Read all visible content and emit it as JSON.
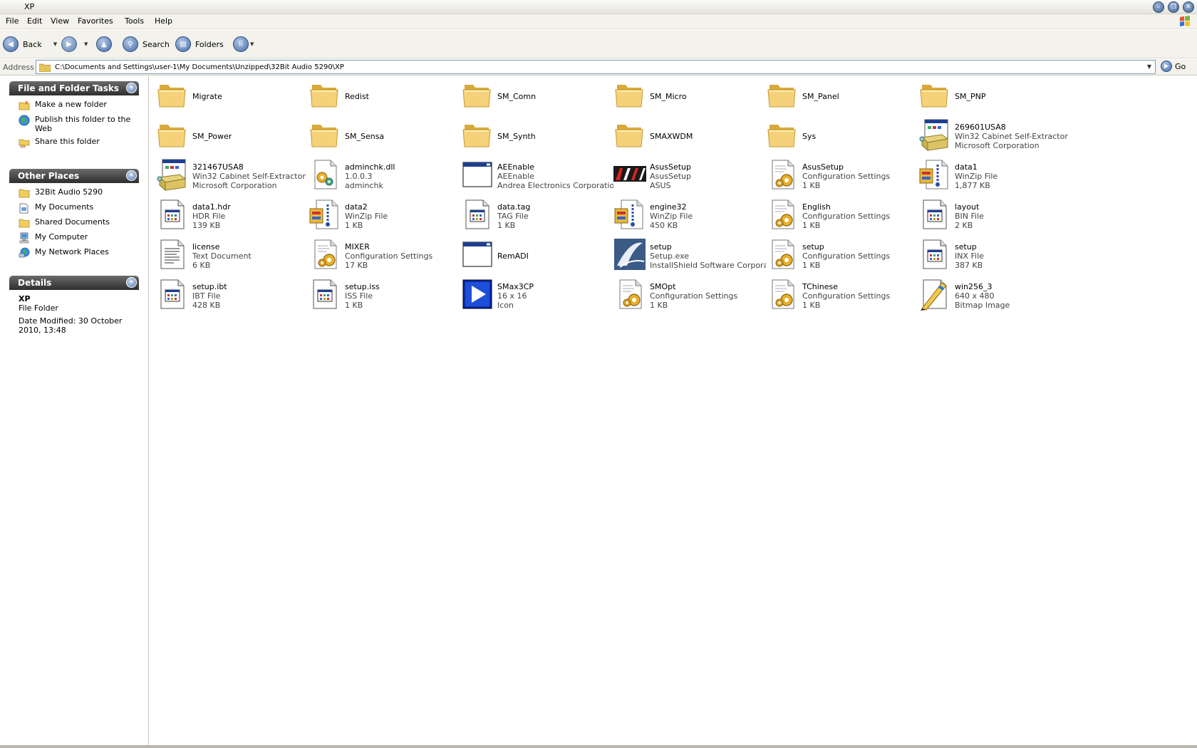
{
  "window": {
    "title": "XP"
  },
  "menu": [
    "File",
    "Edit",
    "View",
    "Favorites",
    "Tools",
    "Help"
  ],
  "toolbar": {
    "back": "Back",
    "search": "Search",
    "folders": "Folders"
  },
  "address": {
    "label": "Address",
    "path": "C:\\Documents and Settings\\user-1\\My Documents\\Unzipped\\32Bit Audio 5290\\XP",
    "go": "Go"
  },
  "tasks": {
    "title": "File and Folder Tasks",
    "items": [
      {
        "label": "Make a new folder",
        "icon": "new-folder-icon"
      },
      {
        "label": "Publish this folder to the Web",
        "icon": "globe-icon"
      },
      {
        "label": "Share this folder",
        "icon": "share-folder-icon"
      }
    ]
  },
  "places": {
    "title": "Other Places",
    "items": [
      {
        "label": "32Bit Audio 5290",
        "icon": "folder-icon"
      },
      {
        "label": "My Documents",
        "icon": "documents-icon"
      },
      {
        "label": "Shared Documents",
        "icon": "folder-icon"
      },
      {
        "label": "My Computer",
        "icon": "computer-icon"
      },
      {
        "label": "My Network Places",
        "icon": "network-icon"
      }
    ]
  },
  "details": {
    "title": "Details",
    "name": "XP",
    "type": "File Folder",
    "modified": "Date Modified: 30 October 2010, 13:48"
  },
  "files": [
    {
      "name": "Migrate",
      "icon": "folder"
    },
    {
      "name": "Redist",
      "icon": "folder"
    },
    {
      "name": "SM_Comn",
      "icon": "folder"
    },
    {
      "name": "SM_Micro",
      "icon": "folder"
    },
    {
      "name": "SM_Panel",
      "icon": "folder"
    },
    {
      "name": "SM_PNP",
      "icon": "folder"
    },
    {
      "name": "SM_Power",
      "icon": "folder"
    },
    {
      "name": "SM_Sensa",
      "icon": "folder"
    },
    {
      "name": "SM_Synth",
      "icon": "folder"
    },
    {
      "name": "SMAXWDM",
      "icon": "folder"
    },
    {
      "name": "Sys",
      "icon": "folder"
    },
    {
      "name": "269601USA8",
      "line2": "Win32 Cabinet Self-Extractor",
      "line3": "Microsoft Corporation",
      "icon": "installer"
    },
    {
      "name": "321467USA8",
      "line2": "Win32 Cabinet Self-Extractor",
      "line3": "Microsoft Corporation",
      "icon": "installer"
    },
    {
      "name": "adminchk.dll",
      "line2": "1.0.0.3",
      "line3": "adminchk",
      "icon": "dll"
    },
    {
      "name": "AEEnable",
      "line2": "AEEnable",
      "line3": "Andrea Electronics Corporation",
      "icon": "app"
    },
    {
      "name": "AsusSetup",
      "line2": "AsusSetup",
      "line3": "ASUS",
      "icon": "asus"
    },
    {
      "name": "AsusSetup",
      "line2": "Configuration Settings",
      "line3": "1 KB",
      "icon": "config"
    },
    {
      "name": "data1",
      "line2": "WinZip File",
      "line3": "1,877 KB",
      "icon": "zip"
    },
    {
      "name": "data1.hdr",
      "line2": "HDR File",
      "line3": "139 KB",
      "icon": "generic"
    },
    {
      "name": "data2",
      "line2": "WinZip File",
      "line3": "1 KB",
      "icon": "zip"
    },
    {
      "name": "data.tag",
      "line2": "TAG File",
      "line3": "1 KB",
      "icon": "generic"
    },
    {
      "name": "engine32",
      "line2": "WinZip File",
      "line3": "450 KB",
      "icon": "zip"
    },
    {
      "name": "English",
      "line2": "Configuration Settings",
      "line3": "1 KB",
      "icon": "config"
    },
    {
      "name": "layout",
      "line2": "BIN File",
      "line3": "2 KB",
      "icon": "generic"
    },
    {
      "name": "license",
      "line2": "Text Document",
      "line3": "6 KB",
      "icon": "text"
    },
    {
      "name": "MIXER",
      "line2": "Configuration Settings",
      "line3": "17 KB",
      "icon": "config"
    },
    {
      "name": "RemADI",
      "icon": "app"
    },
    {
      "name": "setup",
      "line2": "Setup.exe",
      "line3": "InstallShield Software Corpora...",
      "icon": "installshield"
    },
    {
      "name": "setup",
      "line2": "Configuration Settings",
      "line3": "1 KB",
      "icon": "config"
    },
    {
      "name": "setup",
      "line2": "INX File",
      "line3": "387 KB",
      "icon": "generic"
    },
    {
      "name": "setup.ibt",
      "line2": "IBT File",
      "line3": "428 KB",
      "icon": "generic"
    },
    {
      "name": "setup.iss",
      "line2": "ISS File",
      "line3": "1 KB",
      "icon": "generic"
    },
    {
      "name": "SMax3CP",
      "line2": "16 x 16",
      "line3": "Icon",
      "icon": "play"
    },
    {
      "name": "SMOpt",
      "line2": "Configuration Settings",
      "line3": "1 KB",
      "icon": "config"
    },
    {
      "name": "TChinese",
      "line2": "Configuration Settings",
      "line3": "1 KB",
      "icon": "config"
    },
    {
      "name": "win256_3",
      "line2": "640 x 480",
      "line3": "Bitmap Image",
      "icon": "bitmap"
    }
  ]
}
